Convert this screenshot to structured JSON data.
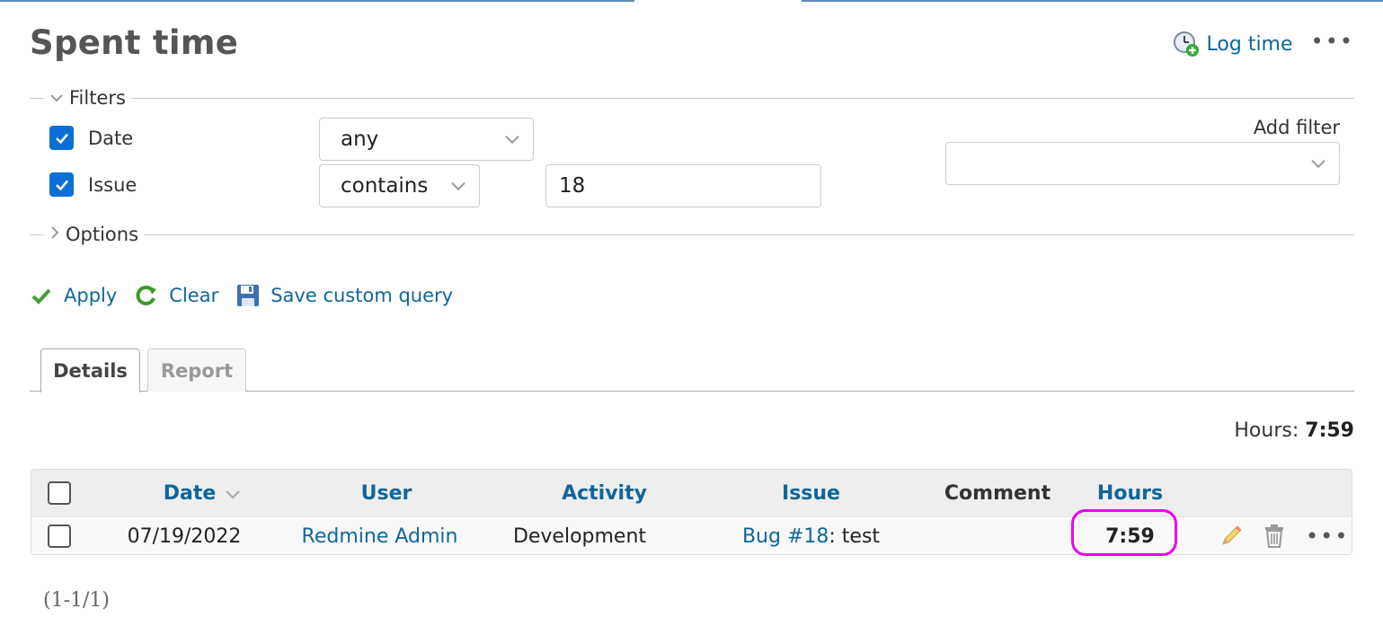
{
  "page": {
    "title": "Spent time",
    "log_time_label": "Log time",
    "more_label": "•••"
  },
  "filters": {
    "legend": "Filters",
    "rows": [
      {
        "label": "Date",
        "checked": true,
        "operator": "any",
        "value": ""
      },
      {
        "label": "Issue",
        "checked": true,
        "operator": "contains",
        "value": "18"
      }
    ],
    "add_filter_label": "Add filter",
    "add_filter_value": ""
  },
  "options": {
    "legend": "Options"
  },
  "actions": {
    "apply": "Apply",
    "clear": "Clear",
    "save": "Save custom query"
  },
  "tabs": [
    {
      "label": "Details",
      "selected": true
    },
    {
      "label": "Report",
      "selected": false
    }
  ],
  "total": {
    "label": "Hours:",
    "value": "7:59"
  },
  "table": {
    "headers": {
      "date": "Date",
      "user": "User",
      "activity": "Activity",
      "issue": "Issue",
      "comment": "Comment",
      "hours": "Hours"
    },
    "rows": [
      {
        "date": "07/19/2022",
        "user": "Redmine Admin",
        "activity": "Development",
        "issue_link": "Bug #18",
        "issue_subject": ": test",
        "comment": "",
        "hours": "7:59"
      }
    ]
  },
  "pagination": "(1-1/1)",
  "colors": {
    "link": "#116699",
    "checkbox": "#0a6fd6",
    "highlight": "#ee00ee"
  }
}
